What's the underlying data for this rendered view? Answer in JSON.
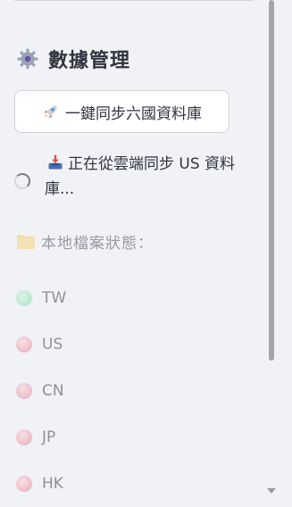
{
  "sidebar": {
    "section_title": "數據管理",
    "sync_button_label": "一鍵同步六國資料庫",
    "status_text": "正在從雲端同步 US 資料庫...",
    "local_files_title": "本地檔案狀態：",
    "databases": [
      {
        "label": "TW",
        "status": "available",
        "color": "#74d39b"
      },
      {
        "label": "US",
        "status": "missing",
        "color": "#e2667e"
      },
      {
        "label": "CN",
        "status": "missing",
        "color": "#e2667e"
      },
      {
        "label": "JP",
        "status": "missing",
        "color": "#e2667e"
      },
      {
        "label": "HK",
        "status": "missing",
        "color": "#e2667e"
      }
    ]
  },
  "icons": {
    "section": "gear-icon",
    "sync_button": "rocket-icon",
    "status": "inbox-tray-icon",
    "local_files": "folder-icon"
  }
}
